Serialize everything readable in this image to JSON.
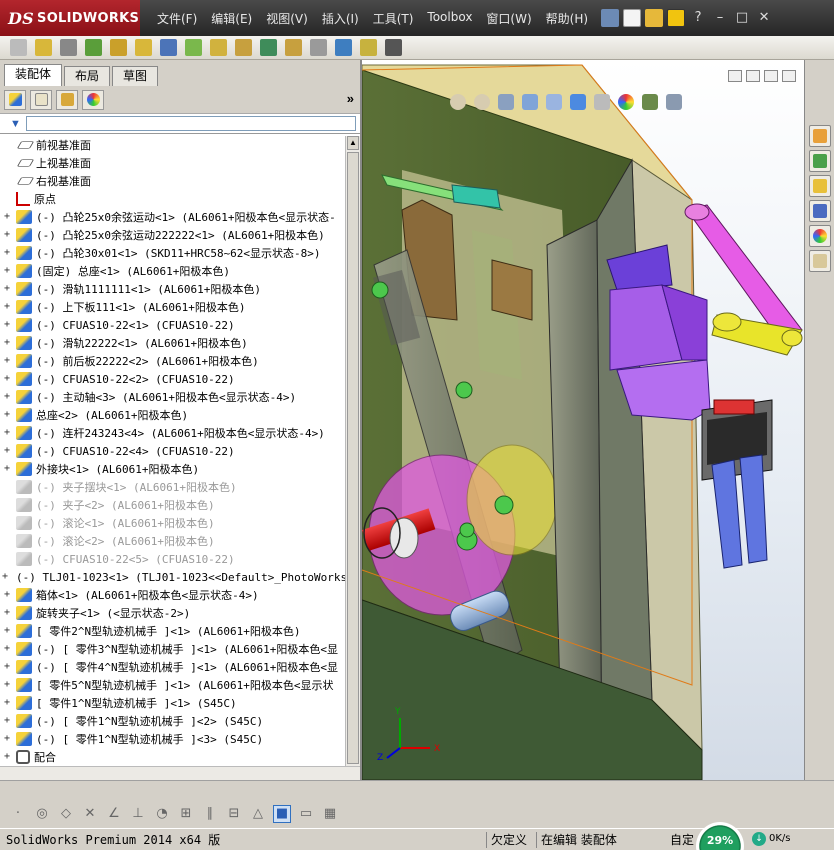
{
  "app": {
    "logo_prefix": "DS",
    "logo_text": "SOLIDWORKS"
  },
  "menu": [
    "文件(F)",
    "编辑(E)",
    "视图(V)",
    "插入(I)",
    "工具(T)",
    "Toolbox",
    "窗口(W)",
    "帮助(H)"
  ],
  "window_controls": [
    "?",
    "–",
    "□",
    "✕"
  ],
  "tabs": [
    {
      "label": "装配体",
      "active": true
    },
    {
      "label": "布局",
      "active": false
    },
    {
      "label": "草图",
      "active": false
    }
  ],
  "panel_more": "»",
  "tree": [
    {
      "label": "前视基准面",
      "icon": "plane-icon",
      "expand": "",
      "suppressed": false
    },
    {
      "label": "上视基准面",
      "icon": "plane-icon",
      "expand": "",
      "suppressed": false
    },
    {
      "label": "右视基准面",
      "icon": "plane-icon",
      "expand": "",
      "suppressed": false
    },
    {
      "label": "原点",
      "icon": "origin-icon",
      "expand": "",
      "suppressed": false
    },
    {
      "label": "(-) 凸轮25x0余弦运动<1> (AL6061+阳极本色<显示状态-",
      "icon": "part-icon",
      "expand": "+",
      "suppressed": false
    },
    {
      "label": "(-) 凸轮25x0余弦运动222222<1> (AL6061+阳极本色)",
      "icon": "part-icon",
      "expand": "+",
      "suppressed": false
    },
    {
      "label": "(-) 凸轮30x01<1> (SKD11+HRC58~62<显示状态-8>)",
      "icon": "part-icon",
      "expand": "+",
      "suppressed": false
    },
    {
      "label": "(固定) 总座<1> (AL6061+阳极本色)",
      "icon": "part-icon",
      "expand": "+",
      "suppressed": false
    },
    {
      "label": "(-) 滑轨1111111<1> (AL6061+阳极本色)",
      "icon": "part-icon",
      "expand": "+",
      "suppressed": false
    },
    {
      "label": "(-) 上下板111<1> (AL6061+阳极本色)",
      "icon": "part-icon",
      "expand": "+",
      "suppressed": false
    },
    {
      "label": "(-) CFUAS10-22<1> (CFUAS10-22)",
      "icon": "part-icon",
      "expand": "+",
      "suppressed": false
    },
    {
      "label": "(-) 滑轨22222<1> (AL6061+阳极本色)",
      "icon": "part-icon",
      "expand": "+",
      "suppressed": false
    },
    {
      "label": "(-) 前后板22222<2> (AL6061+阳极本色)",
      "icon": "part-icon",
      "expand": "+",
      "suppressed": false
    },
    {
      "label": "(-) CFUAS10-22<2> (CFUAS10-22)",
      "icon": "part-icon",
      "expand": "+",
      "suppressed": false
    },
    {
      "label": "(-) 主动轴<3> (AL6061+阳极本色<显示状态-4>)",
      "icon": "part-icon",
      "expand": "+",
      "suppressed": false
    },
    {
      "label": "总座<2> (AL6061+阳极本色)",
      "icon": "part-icon",
      "expand": "+",
      "suppressed": false
    },
    {
      "label": "(-) 连杆243243<4> (AL6061+阳极本色<显示状态-4>)",
      "icon": "part-icon",
      "expand": "+",
      "suppressed": false
    },
    {
      "label": "(-) CFUAS10-22<4> (CFUAS10-22)",
      "icon": "part-icon",
      "expand": "+",
      "suppressed": false
    },
    {
      "label": "外接块<1> (AL6061+阳极本色)",
      "icon": "part-icon",
      "expand": "+",
      "suppressed": false
    },
    {
      "label": "(-) 夹子摆块<1> (AL6061+阳极本色)",
      "icon": "suppressed-part-icon",
      "expand": "",
      "suppressed": true
    },
    {
      "label": "(-) 夹子<2> (AL6061+阳极本色)",
      "icon": "suppressed-part-icon",
      "expand": "",
      "suppressed": true
    },
    {
      "label": "(-) 滚论<1> (AL6061+阳极本色)",
      "icon": "suppressed-part-icon",
      "expand": "",
      "suppressed": true
    },
    {
      "label": "(-) 滚论<2> (AL6061+阳极本色)",
      "icon": "suppressed-part-icon",
      "expand": "",
      "suppressed": true
    },
    {
      "label": "(-) CFUAS10-22<5> (CFUAS10-22)",
      "icon": "suppressed-part-icon",
      "expand": "",
      "suppressed": true
    },
    {
      "label": "(-) TLJ01-1023<1> (TLJ01-1023<<Default>_PhotoWorks",
      "icon": "part-icon",
      "expand": "+",
      "suppressed": false
    },
    {
      "label": "箱体<1> (AL6061+阳极本色<显示状态-4>)",
      "icon": "part-icon",
      "expand": "+",
      "suppressed": false
    },
    {
      "label": "旋转夹子<1> (<显示状态-2>)",
      "icon": "part-icon",
      "expand": "+",
      "suppressed": false
    },
    {
      "label": "[ 零件2^N型轨迹机械手 ]<1> (AL6061+阳极本色)",
      "icon": "part-icon",
      "expand": "+",
      "suppressed": false
    },
    {
      "label": "(-) [ 零件3^N型轨迹机械手 ]<1> (AL6061+阳极本色<显",
      "icon": "part-icon",
      "expand": "+",
      "suppressed": false
    },
    {
      "label": "(-) [ 零件4^N型轨迹机械手 ]<1> (AL6061+阳极本色<显",
      "icon": "part-icon",
      "expand": "+",
      "suppressed": false
    },
    {
      "label": "[ 零件5^N型轨迹机械手 ]<1> (AL6061+阳极本色<显示状",
      "icon": "part-icon",
      "expand": "+",
      "suppressed": false
    },
    {
      "label": "[ 零件1^N型轨迹机械手 ]<1> (S45C)",
      "icon": "part-icon",
      "expand": "+",
      "suppressed": false
    },
    {
      "label": "(-) [ 零件1^N型轨迹机械手 ]<2> (S45C)",
      "icon": "part-icon",
      "expand": "+",
      "suppressed": false
    },
    {
      "label": "(-) [ 零件1^N型轨迹机械手 ]<3> (S45C)",
      "icon": "part-icon",
      "expand": "+",
      "suppressed": false
    },
    {
      "label": "配合",
      "icon": "mates-icon",
      "expand": "+",
      "suppressed": false
    }
  ],
  "triad": {
    "x": "X",
    "y": "Y",
    "z": "Z"
  },
  "status": {
    "app": "SolidWorks Premium 2014 x64 版",
    "state": "欠定义",
    "editing": "在编辑 装配体",
    "custom": "自定",
    "net_percent": "29%",
    "net_speed": "0K/s"
  },
  "colors": {
    "frame_green": "#566b33",
    "plate_gray": "#c9c7b0",
    "link_lavender": "#b8b9d3",
    "purple": "#a656e5",
    "magenta": "#e25ce0",
    "yellow": "#e8e41a",
    "orange_outline": "#e07b18",
    "red": "#d51d1d"
  }
}
